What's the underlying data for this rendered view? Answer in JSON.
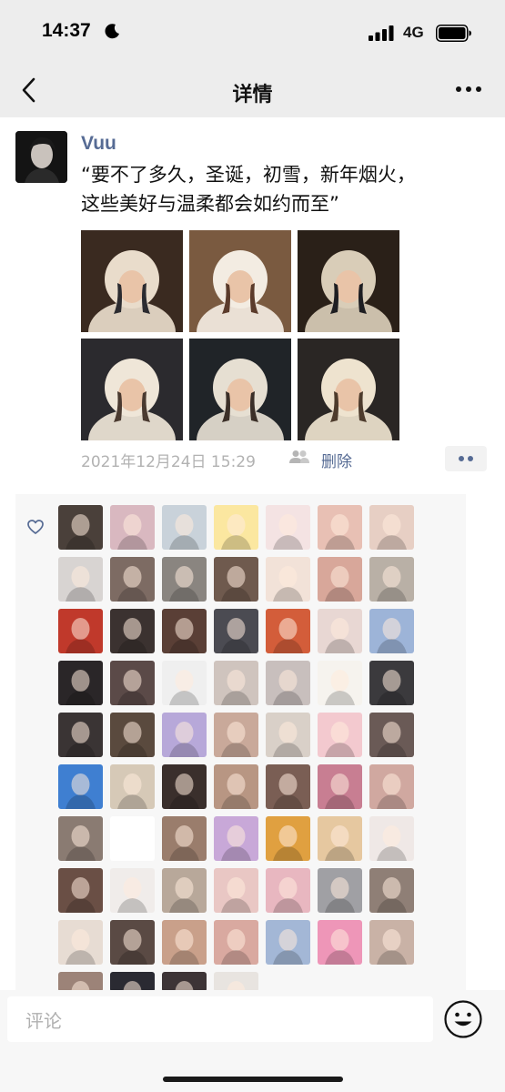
{
  "status_bar": {
    "time": "14:37",
    "network": "4G"
  },
  "nav": {
    "title": "详情",
    "back_icon": "chevron-left-icon",
    "more_icon": "more-dots-icon"
  },
  "post": {
    "author": "Vuu",
    "text_line1": "“要不了多久，圣诞，初雪，新年烟火，",
    "text_line2": "这些美好与温柔都会如约而至”",
    "photos": [
      {
        "palette": [
          "#3a2a20",
          "#e9dccb",
          "#2b2b30"
        ]
      },
      {
        "palette": [
          "#7a5a40",
          "#f3ece2",
          "#5b3b2b"
        ]
      },
      {
        "palette": [
          "#2a2018",
          "#d9cdb8",
          "#1e1e22"
        ]
      },
      {
        "palette": [
          "#2b2a2e",
          "#efe6d8",
          "#4a3a30"
        ]
      },
      {
        "palette": [
          "#202428",
          "#e6dfd2",
          "#3b2f28"
        ]
      },
      {
        "palette": [
          "#2a2624",
          "#eee3cf",
          "#4d3b2c"
        ]
      }
    ],
    "date": "2021年12月24日 15:29",
    "visibility_icon": "people-icon",
    "delete_label": "删除"
  },
  "likes": {
    "heart_icon": "heart-outline-icon",
    "avatars": [
      "#4a403a",
      "#d9b8c0",
      "#c9d2da",
      "#fbe7a0",
      "#f4e3e3",
      "#e8c0b4",
      "#e7cfc4",
      "#d8d4d2",
      "#7d6b63",
      "#8a8580",
      "#6f5a4e",
      "#f2e2d8",
      "#d8a79a",
      "#b9b0a6",
      "#c0392b",
      "#3b3230",
      "#5a3f36",
      "#4b4b52",
      "#d35d3a",
      "#e8d7d3",
      "#9db4d8",
      "#2a2628",
      "#5b4a48",
      "#efefef",
      "#cfc4be",
      "#c8bfbd",
      "#f6f3ee",
      "#3b3a3d",
      "#3a3434",
      "#5a4a3e",
      "#b7a8d9",
      "#c9a99a",
      "#d9d0c8",
      "#f3c9cf",
      "#6a5a56",
      "#3f7fd1",
      "#d6c9b7",
      "#3a2f2c",
      "#b89683",
      "#7a5e54",
      "#c87e92",
      "#d0a8a0",
      "#8a7b72",
      "#ffffff",
      "#9a7d6c",
      "#c8a8d8",
      "#e0a040",
      "#e6c8a0",
      "#efe8e6",
      "#6a4f45",
      "#f0ecea",
      "#b8a89a",
      "#e9c7c4",
      "#e8b7c0",
      "#a0a0a4",
      "#8f7f76",
      "#e7dcd3",
      "#5a4a44",
      "#c9a08a",
      "#d9a9a0",
      "#a3b7d6",
      "#ee96b8",
      "#c9b2a6",
      "#9c8378",
      "#2a2a32",
      "#3d3436",
      "#e8e4e0"
    ]
  },
  "comment_bar": {
    "placeholder": "评论",
    "emoji_icon": "emoji-smile-icon"
  }
}
